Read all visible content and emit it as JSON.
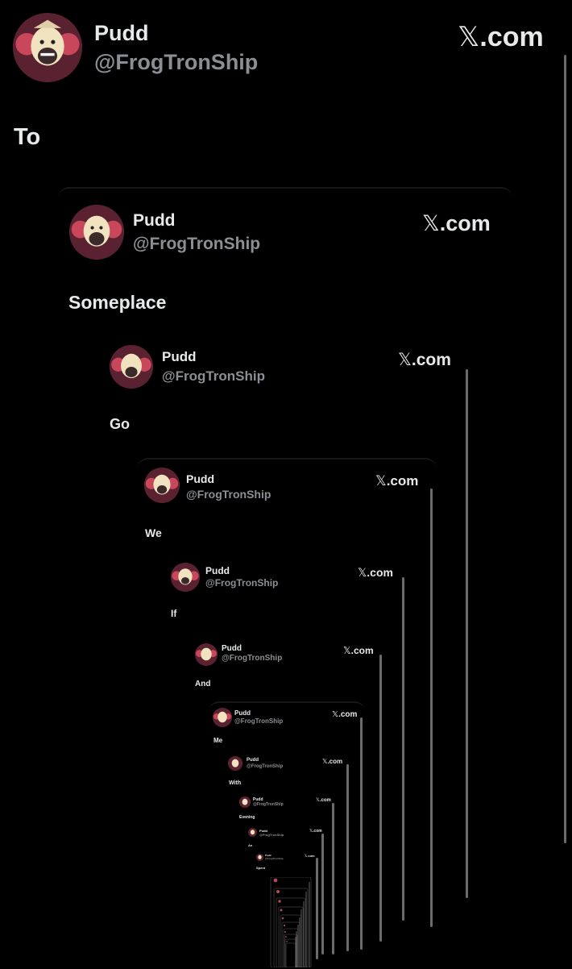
{
  "post": {
    "author_name": "Pudd",
    "author_handle": "@FrogTronShip",
    "brand": "X.com",
    "brand_x": "𝕏",
    "brand_suffix": ".com",
    "avatar": "avatar-icon"
  },
  "levels": [
    {
      "word": "To"
    },
    {
      "word": "Someplace"
    },
    {
      "word": "Go"
    },
    {
      "word": "We"
    },
    {
      "word": "If"
    },
    {
      "word": "And"
    },
    {
      "word": "Me"
    },
    {
      "word": "With"
    },
    {
      "word": "Evening"
    },
    {
      "word": "An"
    },
    {
      "word": "Spent"
    }
  ],
  "colors": {
    "background": "#000000",
    "text": "#e7e9ea",
    "handle": "#8b8f93",
    "rail": "#6b6b6b"
  }
}
